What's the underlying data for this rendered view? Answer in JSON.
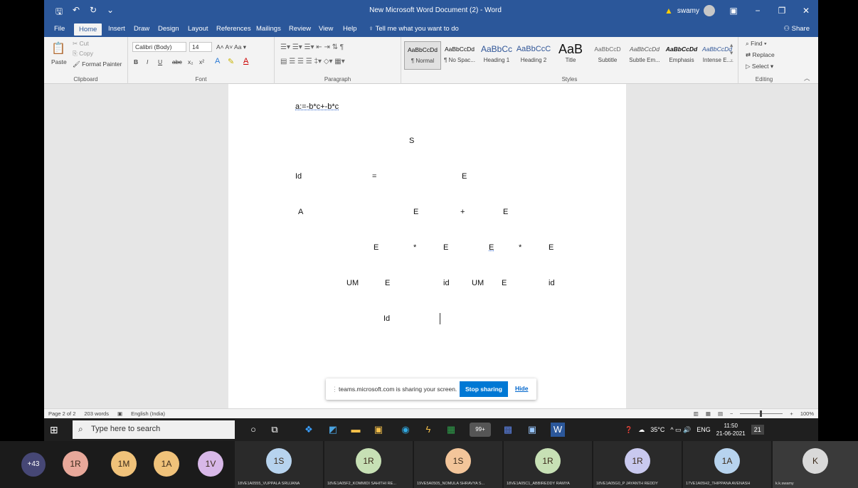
{
  "titlebar": {
    "doc_title": "New Microsoft Word Document (2) - Word",
    "user": "swamy",
    "min": "−",
    "restore": "❐",
    "close": "✕",
    "ribbon_display": "▣"
  },
  "qat": {
    "save": "🖫",
    "undo": "↶",
    "redo": "↻",
    "more": "⌄"
  },
  "tabs": [
    "File",
    "Home",
    "Insert",
    "Draw",
    "Design",
    "Layout",
    "References",
    "Mailings",
    "Review",
    "View",
    "Help"
  ],
  "tell_me": "Tell me what you want to do",
  "share": "Share",
  "clipboard": {
    "paste": "Paste",
    "cut": "Cut",
    "copy": "Copy",
    "format_painter": "Format Painter",
    "label": "Clipboard"
  },
  "font": {
    "name": "Calibri (Body)",
    "size": "14",
    "label": "Font",
    "bold": "B",
    "italic": "I",
    "underline": "U",
    "strike": "abc",
    "sub": "x₂",
    "sup": "x²"
  },
  "paragraph": {
    "label": "Paragraph"
  },
  "styles": {
    "label": "Styles",
    "items": [
      {
        "preview": "AaBbCcDd",
        "name": "¶ Normal"
      },
      {
        "preview": "AaBbCcDd",
        "name": "¶ No Spac..."
      },
      {
        "preview": "AaBbCc",
        "name": "Heading 1"
      },
      {
        "preview": "AaBbCcC",
        "name": "Heading 2"
      },
      {
        "preview": "AaB",
        "name": "Title"
      },
      {
        "preview": "AaBbCcD",
        "name": "Subtitle"
      },
      {
        "preview": "AaBbCcDd",
        "name": "Subtle Em..."
      },
      {
        "preview": "AaBbCcDd",
        "name": "Emphasis"
      },
      {
        "preview": "AaBbCcDd",
        "name": "Intense E..."
      }
    ]
  },
  "editing": {
    "label": "Editing",
    "find": "Find",
    "replace": "Replace",
    "select": "Select"
  },
  "document": {
    "line1": "a:=-b*c+-b*c",
    "tree": {
      "s": "S",
      "id1": "Id",
      "eq": "=",
      "e1": "E",
      "a": "A",
      "e2": "E",
      "plus": "+",
      "e3": "E",
      "e4": "E",
      "star1": "*",
      "e5": "E",
      "e6": "E",
      "star2": "*",
      "e7": "E",
      "um1": "UM",
      "e8": "E",
      "id2": "id",
      "um2": "UM",
      "e9": "E",
      "id3": "id",
      "id4": "Id"
    }
  },
  "sharebar": {
    "message": "teams.microsoft.com is sharing your screen.",
    "stop": "Stop sharing",
    "hide": "Hide"
  },
  "status": {
    "page": "Page 2 of 2",
    "words": "203 words",
    "language": "English (India)",
    "zoom": "100%"
  },
  "taskbar": {
    "search_placeholder": "Type here to search",
    "badge": "99+",
    "temperature": "35°C",
    "lang": "ENG",
    "time": "11:50",
    "date": "21-06-2021",
    "notif": "21"
  },
  "participants": {
    "more": "+43",
    "circles": [
      {
        "initials": "1R",
        "color": "#e8a89a"
      },
      {
        "initials": "1M",
        "color": "#f0c27a"
      },
      {
        "initials": "1A",
        "color": "#f0c27a"
      },
      {
        "initials": "1V",
        "color": "#d8b8e8"
      }
    ],
    "tiles": [
      {
        "initials": "1S",
        "color": "#b7d3ee",
        "name": "18VE1A0555_VUPPALA SRUJANA"
      },
      {
        "initials": "1R",
        "color": "#c7e0b5",
        "name": "18VE1A05F2_KOMMIDI SAHITHI RE..."
      },
      {
        "initials": "1S",
        "color": "#f3c59a",
        "name": "19VE5A0505_NOMULA SHRAVYA S..."
      },
      {
        "initials": "1R",
        "color": "#c7e0b5",
        "name": "18VE1A05C1_ABBIREDDY RAMYA"
      },
      {
        "initials": "1R",
        "color": "#c9c9ef",
        "name": "18VE1A05G0_P JAYANTH REDDY"
      },
      {
        "initials": "1A",
        "color": "#b7d3ee",
        "name": "17VE1A05H2_THIPPANA AVENASH"
      },
      {
        "initials": "K",
        "color": "#d9d9d9",
        "name": "k.k.swamy"
      }
    ]
  }
}
